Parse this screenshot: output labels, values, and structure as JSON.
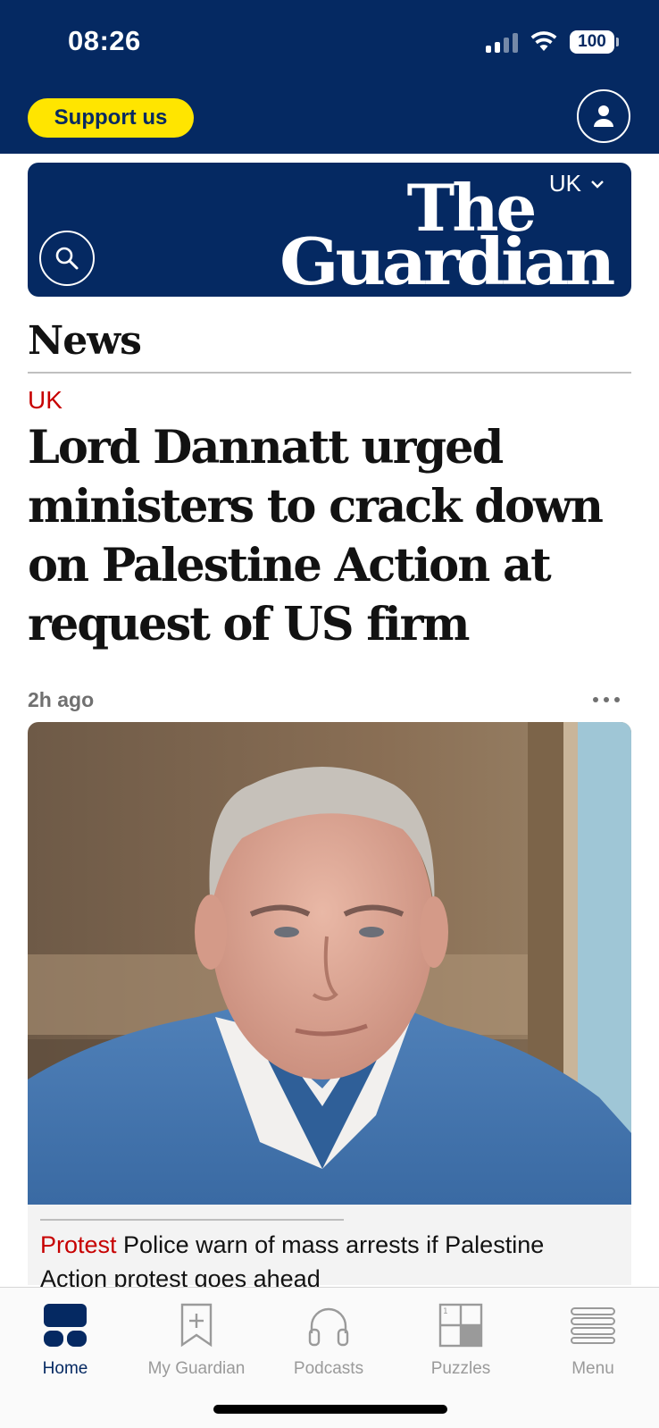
{
  "status_bar": {
    "time": "08:26",
    "battery": "100",
    "icons": [
      "signal-icon",
      "wifi-icon",
      "battery-icon"
    ]
  },
  "header": {
    "support_label": "Support us",
    "account_icon": "account-icon"
  },
  "masthead": {
    "edition_label": "UK",
    "logo_line1": "The",
    "logo_line2": "Guardian",
    "search_icon": "search-icon"
  },
  "section": {
    "title": "News"
  },
  "article": {
    "kicker": "UK",
    "headline": "Lord Dannatt urged ministers to crack down on Palestine Action at request of US firm",
    "age": "2h ago"
  },
  "sublink": {
    "kicker": "Protest",
    "text": " Police warn of mass arrests if Palestine Action protest goes ahead"
  },
  "tabs": [
    {
      "label": "Home",
      "icon": "home-icon",
      "active": true
    },
    {
      "label": "My Guardian",
      "icon": "bookmark-icon",
      "active": false
    },
    {
      "label": "Podcasts",
      "icon": "headphones-icon",
      "active": false
    },
    {
      "label": "Puzzles",
      "icon": "crossword-icon",
      "active": false
    },
    {
      "label": "Menu",
      "icon": "menu-icon",
      "active": false
    }
  ],
  "colors": {
    "brand_blue": "#052962",
    "support_yellow": "#ffe500",
    "kicker_red": "#c70000"
  }
}
